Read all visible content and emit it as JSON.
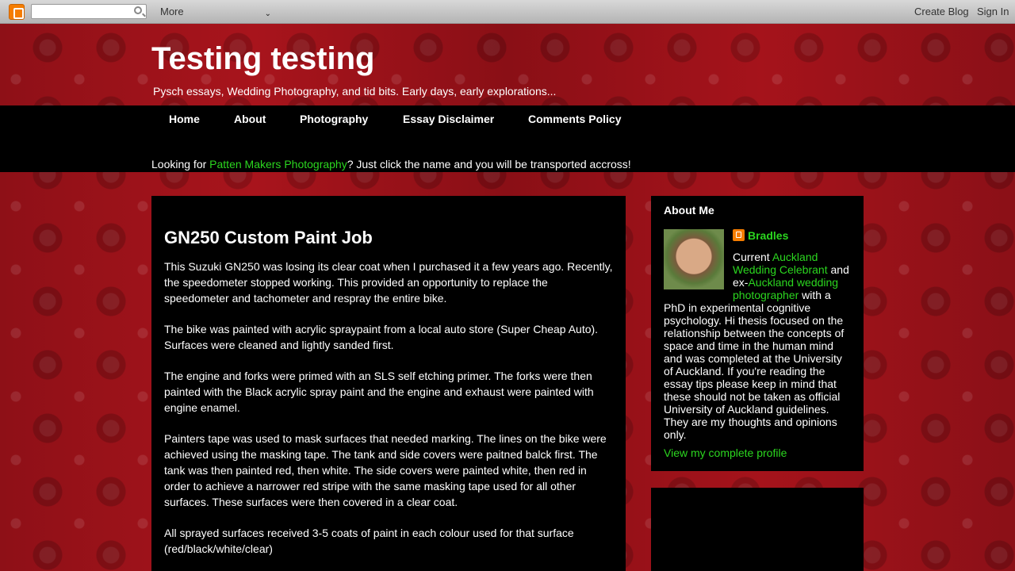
{
  "navbar": {
    "more_label": "More",
    "create_blog": "Create Blog",
    "sign_in": "Sign In"
  },
  "header": {
    "title": "Testing testing",
    "description": "Pysch essays, Wedding Photography, and tid bits. Early days, early explorations..."
  },
  "tabs": [
    "Home",
    "About",
    "Photography",
    "Essay Disclaimer",
    "Comments Policy"
  ],
  "announcement": {
    "prefix": "Looking for ",
    "link": "Patten Makers Photography",
    "suffix": "? Just click the name and you will be transported accross!"
  },
  "post": {
    "title": "GN250 Custom Paint Job",
    "paragraphs": [
      "This Suzuki GN250 was losing its clear coat when I purchased it a few years ago. Recently, the speedometer stopped working. This provided an opportunity to replace the speedometer and tachometer and respray the entire bike.",
      "The bike was painted with acrylic spraypaint from a local auto store (Super Cheap Auto). Surfaces were cleaned and lightly sanded first.",
      "The engine and forks were primed with an SLS self etching primer. The forks were then painted with the Black acrylic spray paint and the engine and exhaust were painted with engine enamel.",
      "Painters tape was used to mask surfaces that needed marking. The lines on the bike were achieved using the masking tape. The tank and side covers were paitned balck first. The tank was then painted red, then white. The side covers were painted white, then red in order to achieve a narrower red stripe with the same masking tape used for all other surfaces. These surfaces were then covered in a clear coat.",
      "All sprayed surfaces received 3-5 coats of paint in each colour used for that surface (red/black/white/clear)"
    ]
  },
  "sidebar": {
    "widget_title": "About Me",
    "profile_name": "Bradles",
    "about": {
      "t1": "Current ",
      "link1": "Auckland Wedding Celebrant",
      "t2": " and ex-",
      "link2": "Auckland wedding photographer",
      "t3": " with a PhD in experimental cognitive psychology. Hi thesis focused on the relationship between the concepts of space and time in the human mind and was completed at the University of Auckland. If you're reading the essay tips please keep in mind that these should not be taken as official University of Auckland guidelines. They are my thoughts and opinions only."
    },
    "view_profile": "View my complete profile"
  },
  "colors": {
    "link": "#2bd61f",
    "background": "#8e1017",
    "panel": "#000000"
  }
}
